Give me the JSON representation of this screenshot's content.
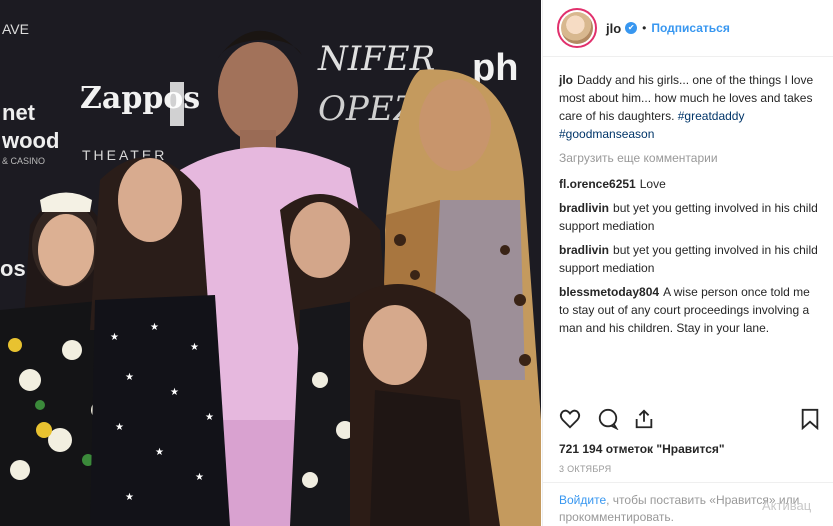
{
  "post": {
    "username": "jlo",
    "follow_label": "Подписаться",
    "dot": "•",
    "verified_mark": "✔"
  },
  "photo": {
    "backdrop_text": {
      "zappos": "Zappos",
      "theater": "THEATER",
      "nifer": "NIFER",
      "opez": "OPEZ",
      "net": "net",
      "wood": "wood",
      "casino": "& CASINO",
      "ave": "AVE",
      "os": "os",
      "ph": "ph"
    }
  },
  "caption": {
    "username": "jlo",
    "text": "Daddy and his girls... one of the things I love most about him... how much he loves and takes care of his daughters.",
    "tags": "#greatdaddy #goodmanseason"
  },
  "load_more": "Загрузить еще комментарии",
  "comments": [
    {
      "user": "fl.orence6251",
      "text": "Love"
    },
    {
      "user": "bradlivin",
      "text": "but yet you getting involved in his child support mediation"
    },
    {
      "user": "bradlivin",
      "text": "but yet you getting involved in his child support mediation"
    },
    {
      "user": "blessmetoday804",
      "text": "A wise person once told me to stay out of any court proceedings involving a man and his children. Stay in your lane."
    }
  ],
  "likes": "721 194 отметок \"Нравится\"",
  "date": "3 ОКТЯБРЯ",
  "footer": {
    "login": "Войдите",
    "rest": ", чтобы поставить «Нравится» или прокомментировать."
  },
  "watermark": "Активац",
  "icons": [
    "heart-icon",
    "comment-icon",
    "share-icon",
    "bookmark-icon"
  ],
  "colors": {
    "link": "#3897f0",
    "text": "#262626",
    "muted": "#999999",
    "ring": "#e1306c"
  }
}
